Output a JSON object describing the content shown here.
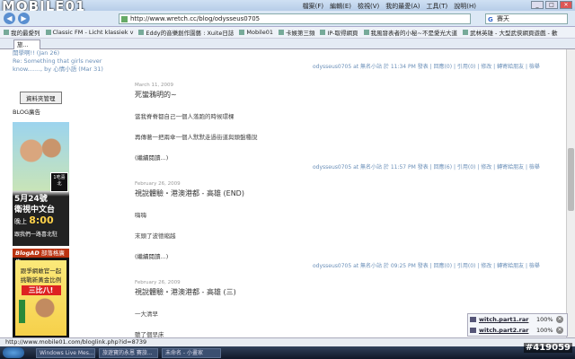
{
  "window": {
    "logo": "MOBILE01",
    "menu": [
      "檔案(F)",
      "編輯(E)",
      "檢視(V)",
      "我的最愛(A)",
      "工具(T)",
      "說明(H)"
    ]
  },
  "address": {
    "url": "http://www.wretch.cc/blog/odysseus0705"
  },
  "search": {
    "value": "賽天"
  },
  "bookmarks": [
    "我的最愛列",
    "Classic FM - Licht klassiek v",
    "Eddy的音樂創作園藝 : Xuite日誌",
    "Mobile01",
    "卡娛第三頻",
    "IP-取得網頁",
    "我風發表者的小秘~不是愛光大道",
    "武林英雄 - 大型武俠網頁遊戲 - 歡"
  ],
  "tab": {
    "label": "旅..."
  },
  "sidebar": {
    "links": [
      "開學啊!! (Jan 26)",
      "Re: Something that girls never",
      "know......., by 心情小語 (Mar 31)"
    ],
    "button": "資料夾管理",
    "blogad_title": "BLOG廣告",
    "ad1": {
      "date": "5月24號",
      "channel": "衛視中文台",
      "time_prefix": "晚上",
      "time": "8:00",
      "sub": "跟我們一路喜北駐",
      "stamp": "1吃喜北"
    },
    "ad2": {
      "header_em": "BlogAD",
      "header": "部落格廣告",
      "line1": "跟爭網敢官一起",
      "line2": "挑戰新黃金比例",
      "highlight": "三比八!"
    }
  },
  "top_meta": "odysseus0705 at 無名小站 於 11:34 PM 發表 | 回應(0) | 引用(0) | 修改 | 轉寄給朋友 | 檢舉",
  "posts": [
    {
      "date": "March 11, 2009",
      "title": "死蠻鴉明的~",
      "lines": [
        "當我脊脊都自己一個人落跑的時候環棵",
        "再傳著一把兩傘一個人默默走過街道與頭盤種說"
      ],
      "more": "(繼續閱讀...)",
      "meta": "odysseus0705 at 無名小站 於 11:57 PM 發表 | 回應(6) | 引用(0) | 修改 | 轉寄給朋友 | 檢舉"
    },
    {
      "date": "February 26, 2009",
      "title": "視說體驗・港澳港都 - 高雄 (END)",
      "lines": [
        "嗨嗨",
        "末頭了波德縮越"
      ],
      "more": "(繼續閱讀...)",
      "meta": "odysseus0705 at 無名小站 於 09:25 PM 發表 | 回應(0) | 引用(0) | 修改 | 轉寄給朋友 | 檢舉"
    },
    {
      "date": "February 26, 2009",
      "title": "視說體驗・港澳港都 - 高雄 (三)",
      "lines": [
        "一大清早",
        "聽了個早床"
      ],
      "more": "",
      "meta": ""
    }
  ],
  "status": {
    "text": "http://www.mobile01.com/bloglink.php?id=8739"
  },
  "downloads": [
    {
      "name": "witch.part1.rar",
      "pct": "100%"
    },
    {
      "name": "witch.part2.rar",
      "pct": "100%"
    }
  ],
  "taskbar": [
    "Windows Live Mes...",
    "旅遊寶的永恩 賽旅...",
    "未命名 - 小畫家"
  ],
  "watermark": "#419059"
}
